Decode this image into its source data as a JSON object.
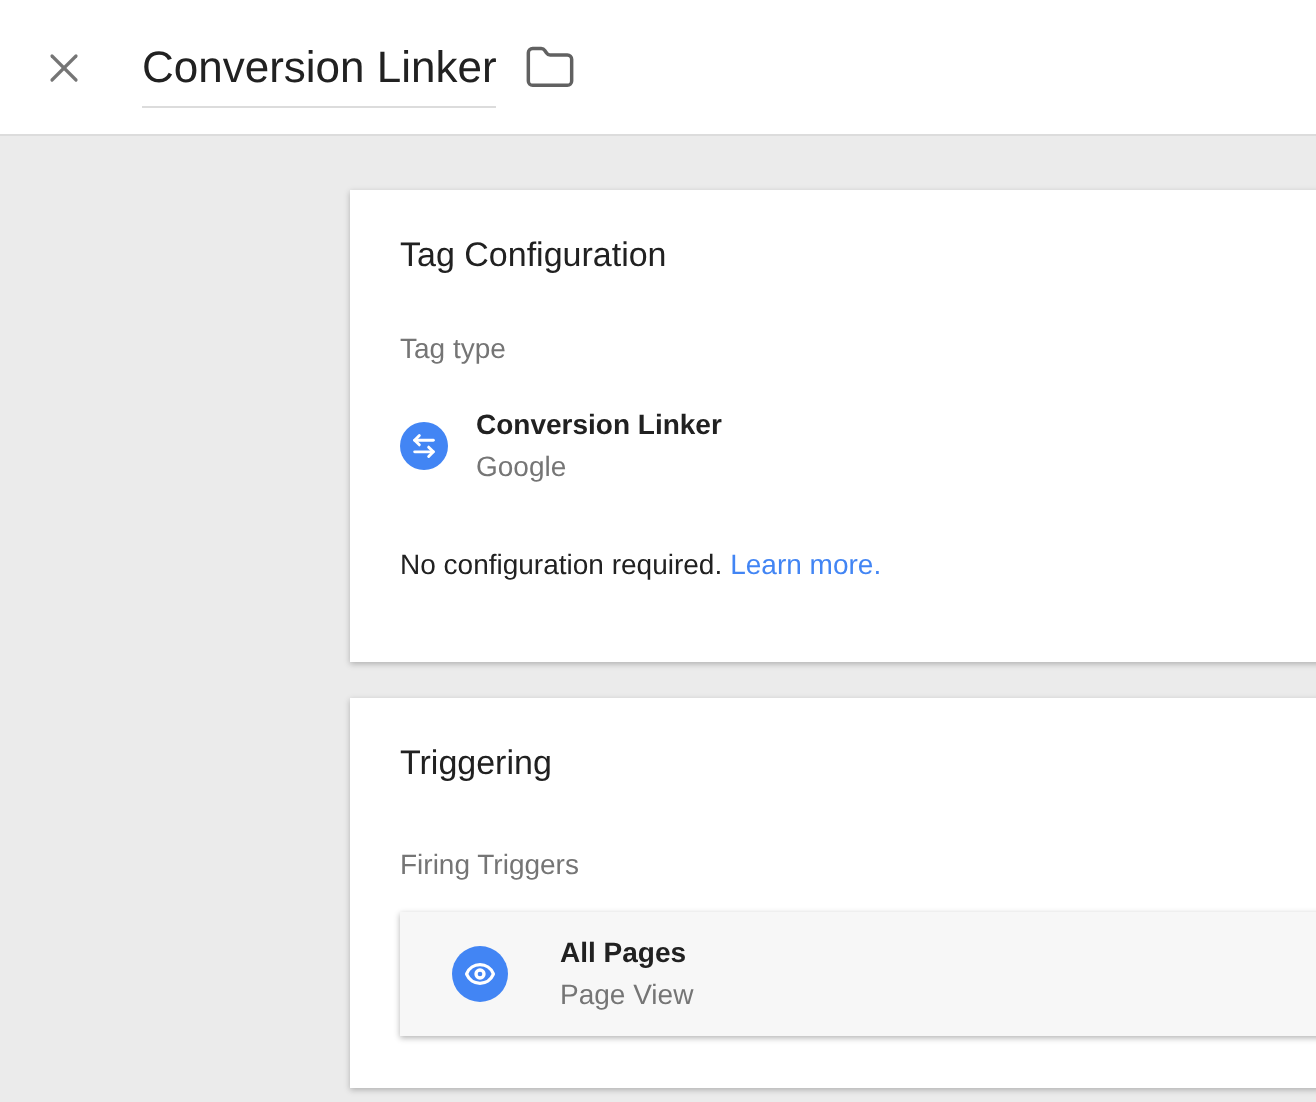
{
  "header": {
    "title": "Conversion Linker"
  },
  "tag_configuration": {
    "title": "Tag Configuration",
    "section_label": "Tag type",
    "tag": {
      "name": "Conversion Linker",
      "vendor": "Google"
    },
    "note": "No configuration required.",
    "link": "Learn more."
  },
  "triggering": {
    "title": "Triggering",
    "section_label": "Firing Triggers",
    "triggers": [
      {
        "name": "All Pages",
        "type": "Page View"
      }
    ]
  }
}
